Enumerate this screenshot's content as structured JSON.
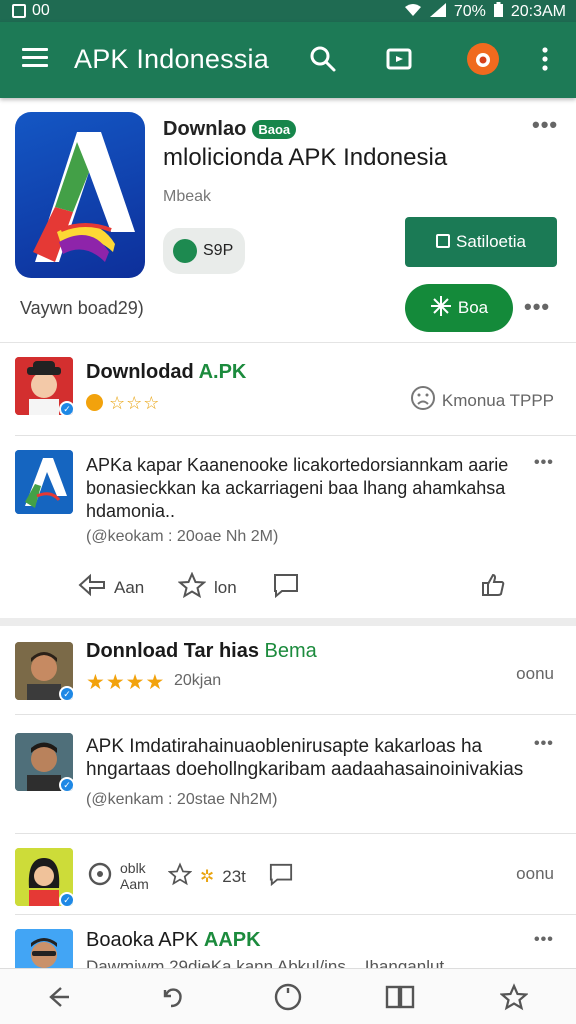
{
  "status": {
    "left_text": "00",
    "battery": "70%",
    "time": "20:3AM"
  },
  "appbar": {
    "title": "APK Indonessia"
  },
  "app": {
    "title": "Downlao",
    "badge": "Baoa",
    "name": "mlolicionda APK Indonesia",
    "meta": "Mbeak",
    "pill_label": "S9P",
    "primary_button": "Satiloetia",
    "secondary_button": "Boa",
    "downloads": "Vaywn boad29)"
  },
  "reviews": [
    {
      "title": "Downlodad",
      "title_accent": "A.PK",
      "rating_label": "Kmonua TPPP"
    },
    {
      "text": "APKa kapar Kaanenooke licakortedorsiannkam aarie bonasieckkan ka ackarriageni baa lhang ahamkahsa hdamonia..",
      "sub": "(@keokam : 20oae  Nh 2M)",
      "actions": [
        "Aan",
        "lon",
        ""
      ]
    },
    {
      "title": "Donnload Tar hias",
      "title_accent": "Bema",
      "sub": "20kjan",
      "right": "oonu"
    },
    {
      "text": "APK Imdatirahainuaoblenirusapte kakarloas ha hngartaas doehollngkaribam aadaahasainoinivakias",
      "sub": "(@kenkam : 20stae  Nh2M)"
    },
    {
      "meta_top": "oblk",
      "meta_bottom": "Aam",
      "count": "23t",
      "right": "oonu"
    },
    {
      "title": "Boaoka APK",
      "title_accent": "AAPK",
      "snippet": "Dawmiwm 29dieKa kann Abkul/ins... Ihanganlut"
    }
  ]
}
